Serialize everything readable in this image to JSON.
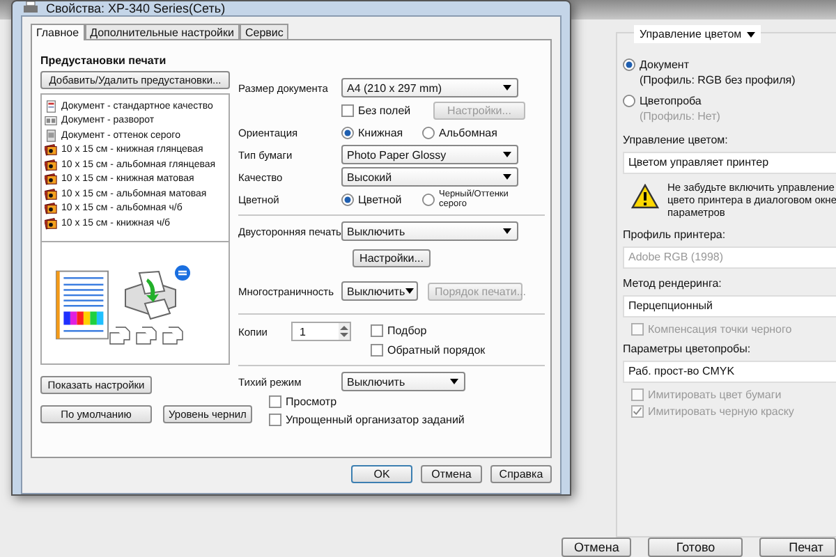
{
  "background_window": {
    "color_panel": {
      "mode_dropdown": "Управление цветом",
      "modes": [
        {
          "label": "Документ",
          "selected": true,
          "profile": "(Профиль: RGB без профиля)"
        },
        {
          "label": "Цветопроба",
          "selected": false,
          "profile": "(Профиль: Нет)"
        }
      ],
      "color_handling": {
        "label": "Управление цветом:",
        "value": "Цветом управляет принтер"
      },
      "warning": "Не забудьте включить управление цвето принтера в диалоговом окне параметров",
      "printer_profile": {
        "label": "Профиль принтера:",
        "value": "Adobe RGB (1998)",
        "disabled": true
      },
      "rendering": {
        "label": "Метод рендеринга:",
        "value": "Перцепционный",
        "disabled": false
      },
      "black_point": {
        "label": "Компенсация точки черного",
        "checked": false,
        "disabled": true
      },
      "proof": {
        "label": "Параметры цветопробы:",
        "value": "Раб. прост-во CMYK",
        "disabled": false
      },
      "proof_options": [
        {
          "label": "Имитировать цвет бумаги",
          "checked": false,
          "disabled": true
        },
        {
          "label": "Имитировать черную краску",
          "checked": true,
          "disabled": true
        }
      ]
    },
    "buttons": [
      "Отмена",
      "Готово",
      "Печат"
    ]
  },
  "dialog": {
    "title": "Свойства: XP-340 Series(Сеть)",
    "tabs": [
      {
        "label": "Главное",
        "selected": true
      },
      {
        "label": "Дополнительные настройки",
        "selected": false
      },
      {
        "label": "Сервис",
        "selected": false
      }
    ],
    "presets": {
      "heading": "Предустановки печати",
      "add_button": "Добавить/Удалить предустановки...",
      "items": [
        {
          "label": "Документ - стандартное качество",
          "kind": "document"
        },
        {
          "label": "Документ - разворот",
          "kind": "spread"
        },
        {
          "label": "Документ - оттенок серого",
          "kind": "grayscale"
        },
        {
          "label": "10  x 15 см - книжная глянцевая",
          "kind": "photo"
        },
        {
          "label": "10 x 15 см - альбомная глянцевая",
          "kind": "photo"
        },
        {
          "label": "10  x 15 см - книжная матовая",
          "kind": "photo"
        },
        {
          "label": "10 x 15 см - альбомная матовая",
          "kind": "photo"
        },
        {
          "label": "10 x 15 см - альбомная ч/б",
          "kind": "photo"
        },
        {
          "label": "10  x 15 см - книжная ч/б",
          "kind": "photo"
        }
      ]
    },
    "show_settings_button": "Показать настройки",
    "defaults_button": "По умолчанию",
    "ink_button": "Уровень чернил",
    "document_size": {
      "label": "Размер документа",
      "value": "A4 (210 x 297 mm)"
    },
    "borderless": {
      "label": "Без полей",
      "checked": false
    },
    "borderless_settings": {
      "label": "Настройки...",
      "disabled": true
    },
    "orientation": {
      "label": "Ориентация",
      "options": [
        {
          "label": "Книжная",
          "selected": true
        },
        {
          "label": "Альбомная",
          "selected": false
        }
      ]
    },
    "paper_type": {
      "label": "Тип бумаги",
      "value": "Photo Paper Glossy"
    },
    "quality": {
      "label": "Качество",
      "value": "Высокий"
    },
    "color": {
      "label": "Цветной",
      "options": [
        {
          "label": "Цветной",
          "selected": true
        },
        {
          "label": "Черный/Оттенки серого",
          "selected": false
        }
      ]
    },
    "duplex": {
      "label": "Двусторонняя печать",
      "value": "Выключить"
    },
    "duplex_settings": {
      "label": "Настройки...",
      "disabled": false
    },
    "multipage": {
      "label": "Многостраничность",
      "value": "Выключить"
    },
    "print_order": {
      "label": "Порядок печати...",
      "disabled": true
    },
    "copies": {
      "label": "Копии",
      "value": "1"
    },
    "copy_options": [
      {
        "label": "Подбор",
        "checked": false
      },
      {
        "label": "Обратный порядок",
        "checked": false
      }
    ],
    "quiet_mode": {
      "label": "Тихий режим",
      "value": "Выключить"
    },
    "quiet_options": [
      {
        "label": "Просмотр",
        "checked": false
      },
      {
        "label": "Упрощенный организатор заданий",
        "checked": false
      }
    ],
    "buttons": [
      "OK",
      "Отмена",
      "Справка"
    ]
  }
}
